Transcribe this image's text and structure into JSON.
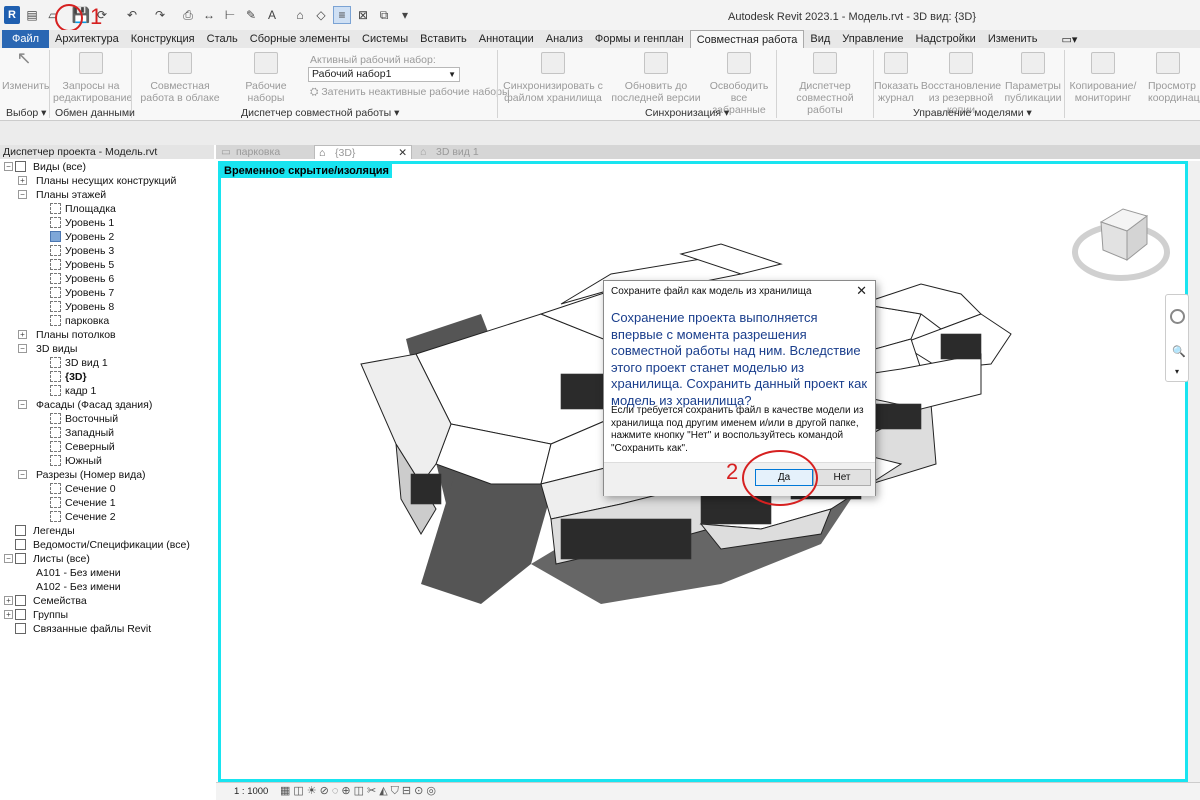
{
  "app": {
    "title": "Autodesk Revit 2023.1 - Модель.rvt - 3D вид: {3D}",
    "logo": "R"
  },
  "quick_access": [
    "open-icon",
    "folder-icon",
    "save-icon",
    "sync-icon",
    "undo-icon",
    "redo-icon",
    "print-icon",
    "measure-icon",
    "dimension-icon",
    "tag-icon",
    "text-icon",
    "3d-view-icon",
    "section-icon",
    "thin-lines-icon",
    "close-hidden-icon",
    "switch-windows-icon",
    "customize-icon"
  ],
  "tabs": [
    "Файл",
    "Архитектура",
    "Конструкция",
    "Сталь",
    "Сборные элементы",
    "Системы",
    "Вставить",
    "Аннотации",
    "Анализ",
    "Формы и генплан",
    "Совместная работа",
    "Вид",
    "Управление",
    "Надстройки",
    "Изменить"
  ],
  "ribbon": {
    "buttons": [
      {
        "label": "Изменить"
      },
      {
        "label": "Запросы на редактирование"
      },
      {
        "label": "Совместная работа в облаке"
      },
      {
        "label": "Рабочие наборы"
      },
      {
        "label": "Синхронизировать с файлом хранилища"
      },
      {
        "label": "Обновить до последней версии"
      },
      {
        "label": "Освободить все забранные"
      },
      {
        "label": "Диспетчер совместной работы"
      },
      {
        "label": "Показать журнал"
      },
      {
        "label": "Восстановление из резервной копии"
      },
      {
        "label": "Параметры публикации"
      },
      {
        "label": "Копирование/ мониторинг"
      },
      {
        "label": "Просмотр координации"
      }
    ],
    "active_set_label": "Активный рабочий набор:",
    "active_set_value": "Рабочий набор1",
    "gray_inactive": "Затенить неактивные рабочие наборы",
    "panels": [
      "Выбор",
      "Обмен данными",
      "Диспетчер совместной работы",
      "Синхронизация",
      "Управление моделями"
    ]
  },
  "browser": {
    "title": "Диспетчер проекта - Модель.rvt",
    "tree": [
      {
        "label": "Виды (все)",
        "level": 0,
        "toggle": "-",
        "icon": "views-icon"
      },
      {
        "label": "Планы несущих конструкций",
        "level": 1,
        "toggle": "+"
      },
      {
        "label": "Планы этажей",
        "level": 1,
        "toggle": "-"
      },
      {
        "label": "Площадка",
        "level": 2
      },
      {
        "label": "Уровень 1",
        "level": 2
      },
      {
        "label": "Уровень 2",
        "level": 2,
        "selected": true
      },
      {
        "label": "Уровень 3",
        "level": 2
      },
      {
        "label": "Уровень 5",
        "level": 2
      },
      {
        "label": "Уровень 6",
        "level": 2
      },
      {
        "label": "Уровень 7",
        "level": 2
      },
      {
        "label": "Уровень 8",
        "level": 2
      },
      {
        "label": "парковка",
        "level": 2
      },
      {
        "label": "Планы потолков",
        "level": 1,
        "toggle": "+"
      },
      {
        "label": "3D виды",
        "level": 1,
        "toggle": "-"
      },
      {
        "label": "3D вид 1",
        "level": 2
      },
      {
        "label": "{3D}",
        "level": 2,
        "bold": true
      },
      {
        "label": "кадр 1",
        "level": 2
      },
      {
        "label": "Фасады (Фасад здания)",
        "level": 1,
        "toggle": "-"
      },
      {
        "label": "Восточный",
        "level": 2
      },
      {
        "label": "Западный",
        "level": 2
      },
      {
        "label": "Северный",
        "level": 2
      },
      {
        "label": "Южный",
        "level": 2
      },
      {
        "label": "Разрезы (Номер вида)",
        "level": 1,
        "toggle": "-"
      },
      {
        "label": "Сечение 0",
        "level": 2
      },
      {
        "label": "Сечение 1",
        "level": 2
      },
      {
        "label": "Сечение 2",
        "level": 2
      },
      {
        "label": "Легенды",
        "level": 0,
        "icon": "legend-icon"
      },
      {
        "label": "Ведомости/Спецификации (все)",
        "level": 0,
        "icon": "schedule-icon"
      },
      {
        "label": "Листы (все)",
        "level": 0,
        "toggle": "-",
        "icon": "sheets-icon"
      },
      {
        "label": "A101 - Без имени",
        "level": 1,
        "leaf": true
      },
      {
        "label": "A102 - Без имени",
        "level": 1,
        "leaf": true
      },
      {
        "label": "Семейства",
        "level": 0,
        "toggle": "+",
        "icon": "families-icon"
      },
      {
        "label": "Группы",
        "level": 0,
        "toggle": "+",
        "icon": "groups-icon"
      },
      {
        "label": "Связанные файлы Revit",
        "level": 0,
        "icon": "link-icon"
      }
    ]
  },
  "doc_tabs": [
    {
      "label": "парковка"
    },
    {
      "label": "{3D}",
      "active": true
    },
    {
      "label": "3D вид 1"
    }
  ],
  "view": {
    "temp_label": "Временное скрытие/изоляция",
    "scale": "1 : 1000"
  },
  "dialog": {
    "title": "Сохраните файл как модель из хранилища",
    "main_text": "Сохранение проекта выполняется впервые с момента разрешения совместной работы над ним. Вследствие этого проект станет моделью из хранилища. Сохранить данный проект как модель из хранилища?",
    "sub_text": "Если требуется сохранить файл в качестве модели из хранилища под другим именем и/или в другой папке, нажмите кнопку \"Нет\" и воспользуйтесь командой \"Сохранить как\".",
    "yes": "Да",
    "no": "Нет"
  },
  "annotations": {
    "step1": "1",
    "step2": "2",
    "color": "#d62020"
  },
  "colors": {
    "accent": "#2a67b3",
    "view_border": "#18e4f0"
  }
}
